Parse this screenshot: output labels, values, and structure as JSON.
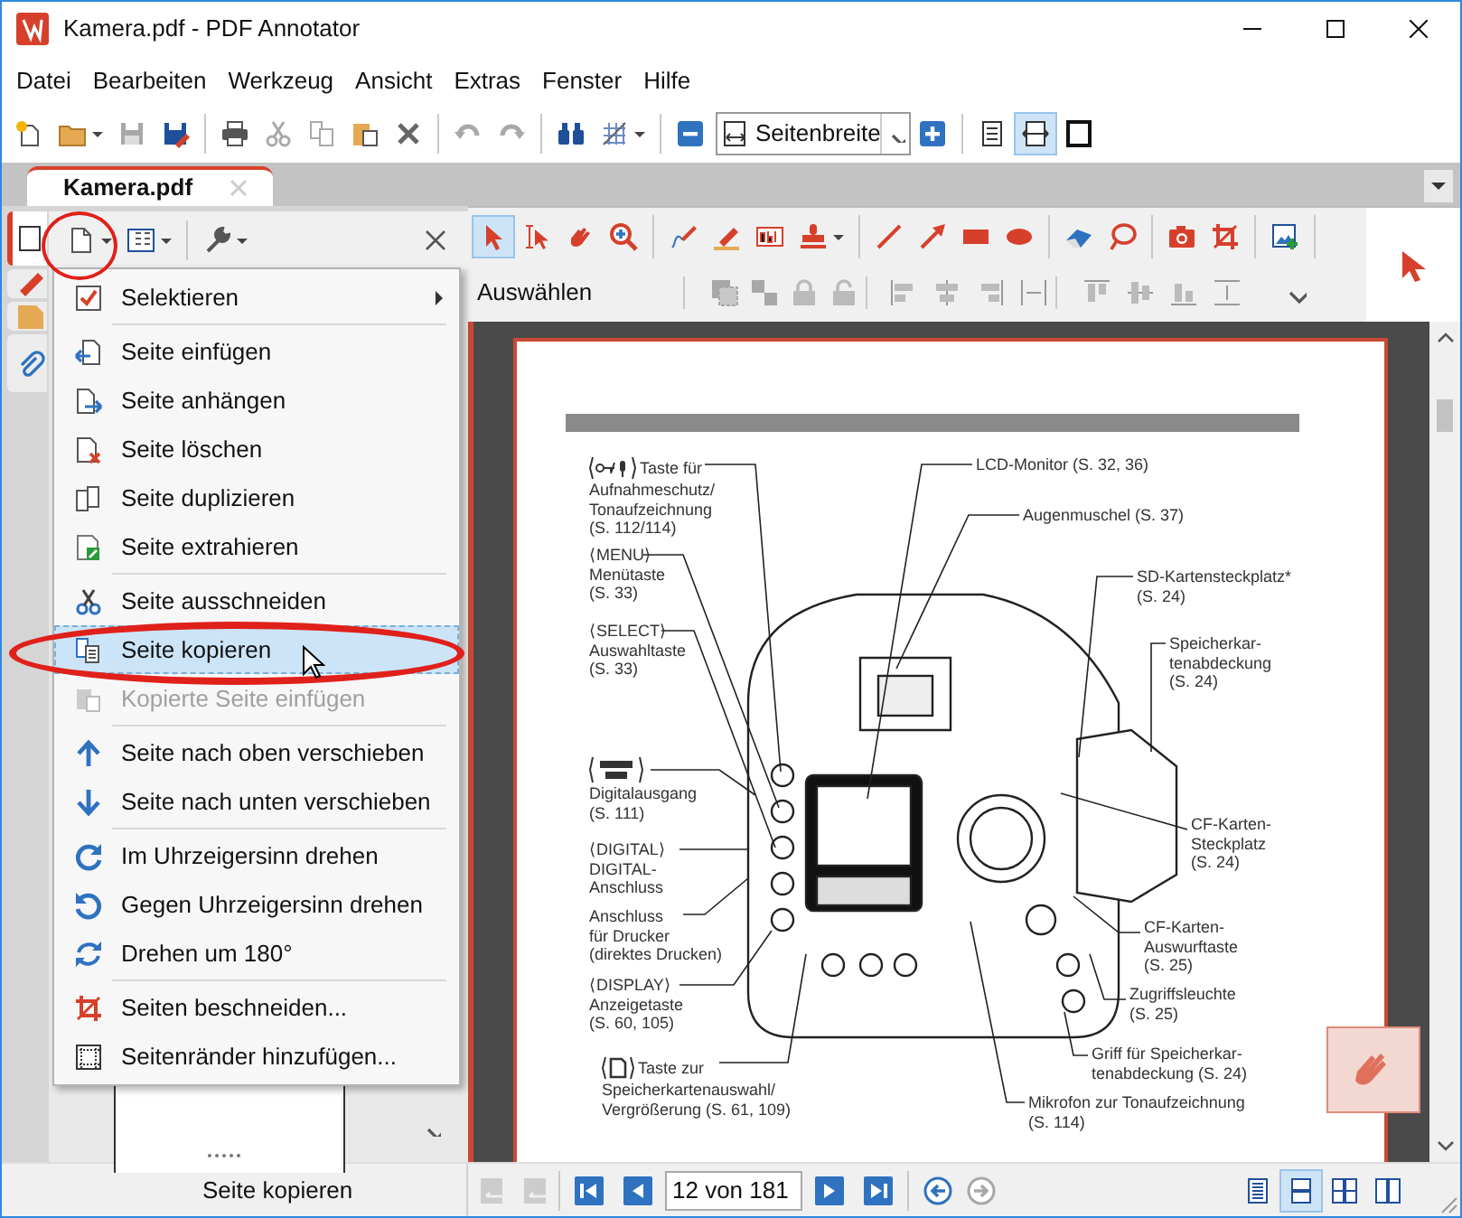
{
  "window": {
    "title": "Kamera.pdf - PDF Annotator"
  },
  "menu_bar": [
    "Datei",
    "Bearbeiten",
    "Werkzeug",
    "Ansicht",
    "Extras",
    "Fenster",
    "Hilfe"
  ],
  "toolbar": {
    "zoom_mode": "Seitenbreite",
    "view_buttons": [
      {
        "selected": false
      },
      {
        "selected": true
      },
      {
        "selected": false
      }
    ]
  },
  "tabs": [
    {
      "label": "Kamera.pdf",
      "selected": true
    }
  ],
  "side_tabs": [
    {
      "selected": true
    },
    {
      "selected": false
    },
    {
      "selected": false
    },
    {
      "selected": false
    }
  ],
  "page_menu": {
    "items": [
      {
        "kind": "item",
        "label": "Selektieren",
        "submenu": true,
        "disabled": false,
        "selected": false
      },
      {
        "kind": "separator"
      },
      {
        "kind": "item",
        "label": "Seite einfügen",
        "submenu": false,
        "disabled": false,
        "selected": false
      },
      {
        "kind": "item",
        "label": "Seite anhängen",
        "submenu": false,
        "disabled": false,
        "selected": false
      },
      {
        "kind": "item",
        "label": "Seite löschen",
        "submenu": false,
        "disabled": false,
        "selected": false
      },
      {
        "kind": "item",
        "label": "Seite duplizieren",
        "submenu": false,
        "disabled": false,
        "selected": false
      },
      {
        "kind": "item",
        "label": "Seite extrahieren",
        "submenu": false,
        "disabled": false,
        "selected": false
      },
      {
        "kind": "separator"
      },
      {
        "kind": "item",
        "label": "Seite ausschneiden",
        "submenu": false,
        "disabled": false,
        "selected": false
      },
      {
        "kind": "item",
        "label": "Seite kopieren",
        "submenu": false,
        "disabled": false,
        "selected": true
      },
      {
        "kind": "item",
        "label": "Kopierte Seite einfügen",
        "submenu": false,
        "disabled": true,
        "selected": false
      },
      {
        "kind": "separator"
      },
      {
        "kind": "item",
        "label": "Seite nach oben verschieben",
        "submenu": false,
        "disabled": false,
        "selected": false
      },
      {
        "kind": "item",
        "label": "Seite nach unten verschieben",
        "submenu": false,
        "disabled": false,
        "selected": false
      },
      {
        "kind": "separator"
      },
      {
        "kind": "item",
        "label": "Im Uhrzeigersinn drehen",
        "submenu": false,
        "disabled": false,
        "selected": false
      },
      {
        "kind": "item",
        "label": "Gegen Uhrzeigersinn drehen",
        "submenu": false,
        "disabled": false,
        "selected": false
      },
      {
        "kind": "item",
        "label": "Drehen um 180°",
        "submenu": false,
        "disabled": false,
        "selected": false
      },
      {
        "kind": "separator"
      },
      {
        "kind": "item",
        "label": "Seiten beschneiden...",
        "submenu": false,
        "disabled": false,
        "selected": false
      },
      {
        "kind": "item",
        "label": "Seitenränder hinzufügen...",
        "submenu": false,
        "disabled": false,
        "selected": false
      }
    ]
  },
  "annotation_toolbar": {
    "tools": [
      {
        "selected": true
      },
      {
        "selected": false
      },
      {
        "selected": false
      },
      {
        "selected": false
      },
      {
        "selected": false
      },
      {
        "selected": false
      },
      {
        "selected": false
      },
      {
        "selected": false
      },
      {
        "selected": false
      },
      {
        "selected": false
      },
      {
        "selected": false
      },
      {
        "selected": false
      },
      {
        "selected": false
      },
      {
        "selected": false
      },
      {
        "selected": false
      },
      {
        "selected": false
      },
      {
        "selected": false
      }
    ],
    "mode_label": "Auswählen"
  },
  "document": {
    "labels": [
      {
        "lines": [
          "Taste für",
          "Aufnahmeschutz/",
          "Tonaufzeichnung",
          "(S. 112/114)"
        ]
      },
      {
        "lines": [
          "⟨MENU⟩",
          "Menütaste",
          "(S. 33)"
        ]
      },
      {
        "lines": [
          "⟨SELECT⟩",
          "Auswahltaste",
          "(S. 33)"
        ]
      },
      {
        "lines": [
          "Digitalausgang",
          "(S. 111)"
        ]
      },
      {
        "lines": [
          "⟨DIGITAL⟩",
          "DIGITAL-",
          "Anschluss"
        ]
      },
      {
        "lines": [
          "Anschluss",
          "für Drucker",
          "(direktes Drucken)"
        ]
      },
      {
        "lines": [
          "⟨DISPLAY⟩",
          "Anzeigetaste",
          "(S. 60, 105)"
        ]
      },
      {
        "lines": [
          "Taste zur",
          "Speicherkartenauswahl/",
          "Vergrößerung (S. 61, 109)"
        ]
      },
      {
        "lines": [
          "LCD-Monitor (S. 32, 36)"
        ]
      },
      {
        "lines": [
          "Augenmuschel (S. 37)"
        ]
      },
      {
        "lines": [
          "SD-Kartensteckplatz*",
          "(S. 24)"
        ]
      },
      {
        "lines": [
          "Speicherkar-",
          "tenabdeckung",
          "(S. 24)"
        ]
      },
      {
        "lines": [
          "CF-Karten-",
          "Steckplatz",
          "(S. 24)"
        ]
      },
      {
        "lines": [
          "CF-Karten-",
          "Auswurftaste",
          "(S. 25)"
        ]
      },
      {
        "lines": [
          "Zugriffsleuchte",
          "(S. 25)"
        ]
      },
      {
        "lines": [
          "Griff für Speicherkar-",
          "tenabdeckung (S. 24)"
        ]
      },
      {
        "lines": [
          "Mikrofon zur Tonaufzeichnung",
          "(S. 114)"
        ]
      }
    ]
  },
  "status_bar": {
    "message": "Seite kopieren",
    "page_field": "12 von 181",
    "view_modes": [
      {
        "selected": false
      },
      {
        "selected": true
      },
      {
        "selected": false
      },
      {
        "selected": false
      }
    ]
  }
}
